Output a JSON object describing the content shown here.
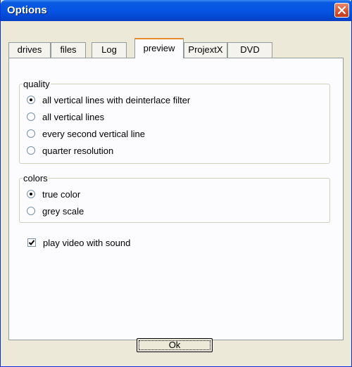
{
  "window": {
    "title": "Options"
  },
  "tabs": [
    {
      "label": "drives"
    },
    {
      "label": "files"
    },
    {
      "label": "Log"
    },
    {
      "label": "preview",
      "active": true
    },
    {
      "label": "ProjextX"
    },
    {
      "label": "DVD"
    }
  ],
  "quality": {
    "legend": "quality",
    "options": [
      {
        "label": "all vertical lines with deinterlace filter",
        "selected": true
      },
      {
        "label": "all vertical lines",
        "selected": false
      },
      {
        "label": "every second vertical line",
        "selected": false
      },
      {
        "label": "quarter resolution",
        "selected": false
      }
    ]
  },
  "colors": {
    "legend": "colors",
    "options": [
      {
        "label": "true color",
        "selected": true
      },
      {
        "label": "grey scale",
        "selected": false
      }
    ]
  },
  "sound": {
    "label": "play video with sound",
    "checked": true
  },
  "ok_button": {
    "label": "Ok"
  },
  "icons": {
    "close": "close-icon"
  },
  "theme": {
    "titlebar": "#0554e3",
    "close": "#d6502f",
    "tab_highlight": "#e68b2c"
  }
}
